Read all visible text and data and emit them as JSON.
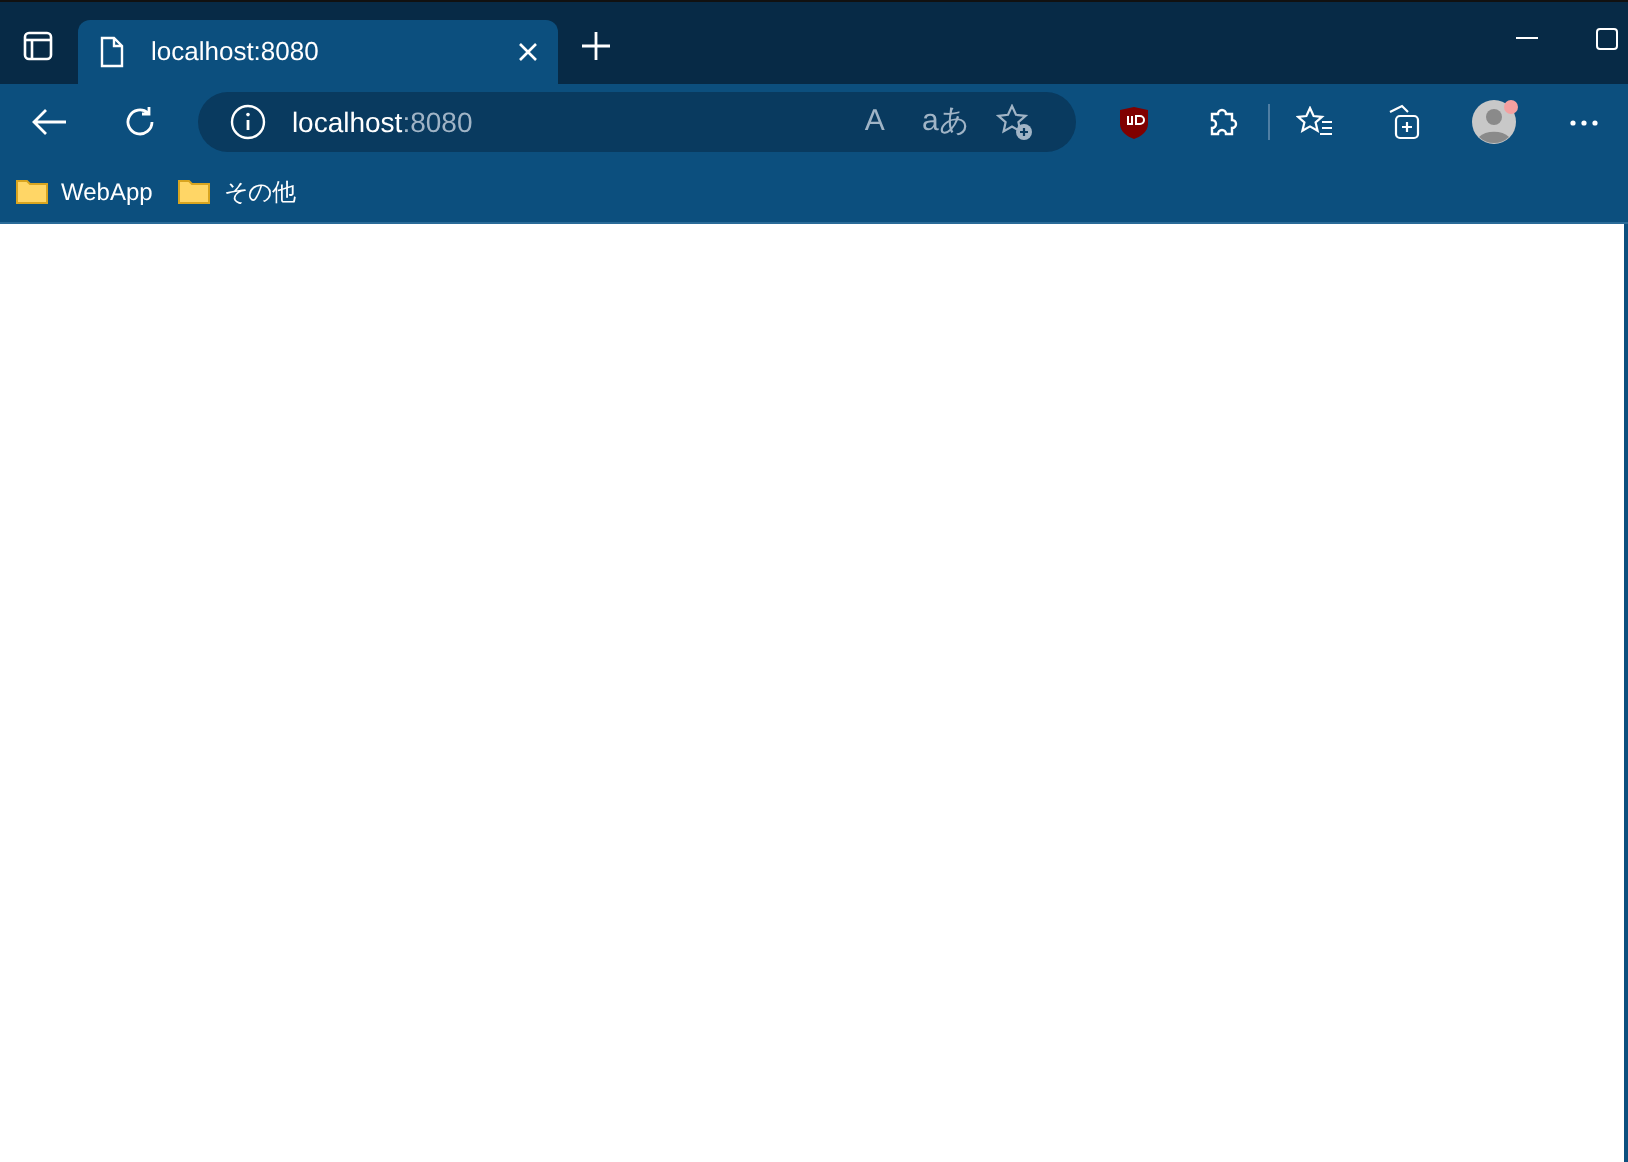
{
  "tab": {
    "title": "localhost:8080",
    "selected": true
  },
  "address": {
    "host": "localhost",
    "port": ":8080"
  },
  "address_actions": [
    {
      "kind": "glyph",
      "text": "A"
    },
    {
      "kind": "glyph",
      "text": "aあ"
    },
    {
      "kind": "favorite"
    }
  ],
  "bookmarks": [
    {
      "label": "WebApp"
    },
    {
      "label": "その他"
    }
  ]
}
